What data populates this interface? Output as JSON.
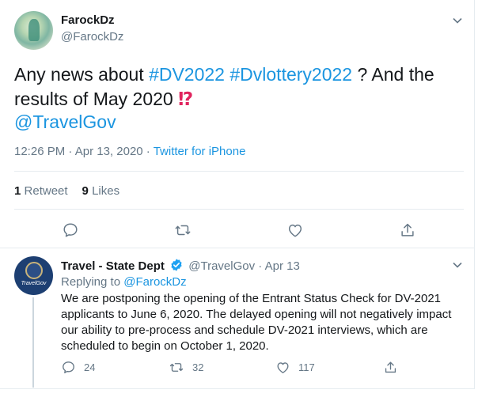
{
  "main_tweet": {
    "author_name": "FarockDz",
    "author_handle": "@FarockDz",
    "text_prefix": "Any news about ",
    "hashtag_1": "#DV2022",
    "hashtag_2": "#Dvlottery2022",
    "text_mid": " ? And the",
    "text_line2": "results of May 2020 ",
    "emoji": "⁉",
    "mention": "@TravelGov",
    "time": "12:26 PM",
    "date": "Apr 13, 2020",
    "separator": " · ",
    "source": "Twitter for iPhone",
    "retweet_count": "1",
    "retweet_label": "Retweet",
    "like_count": "9",
    "like_label": "Likes"
  },
  "reply_tweet": {
    "author_name": "Travel - State Dept",
    "author_handle": "@TravelGov",
    "date": "Apr 13",
    "separator": " · ",
    "replying_label": "Replying to ",
    "replying_to": "@FarockDz",
    "avatar_caption": "TravelGov",
    "text": "We are postponing the opening of the Entrant Status Check for DV-2021 applicants to June 6, 2020. The delayed opening will not negatively impact our ability to pre-process and schedule DV-2021 interviews, which are scheduled to begin on October 1, 2020.",
    "reply_count": "24",
    "retweet_count": "32",
    "like_count": "117"
  },
  "icons": {
    "reply": "comment-icon",
    "retweet": "retweet-icon",
    "like": "heart-icon",
    "share": "share-icon",
    "more": "chevron-down-icon",
    "verified": "verified-badge-icon"
  },
  "colors": {
    "link": "#1b95e0",
    "muted": "#657786",
    "text": "#14171a",
    "interrobang": "#e0245e",
    "verified": "#1da1f2"
  }
}
